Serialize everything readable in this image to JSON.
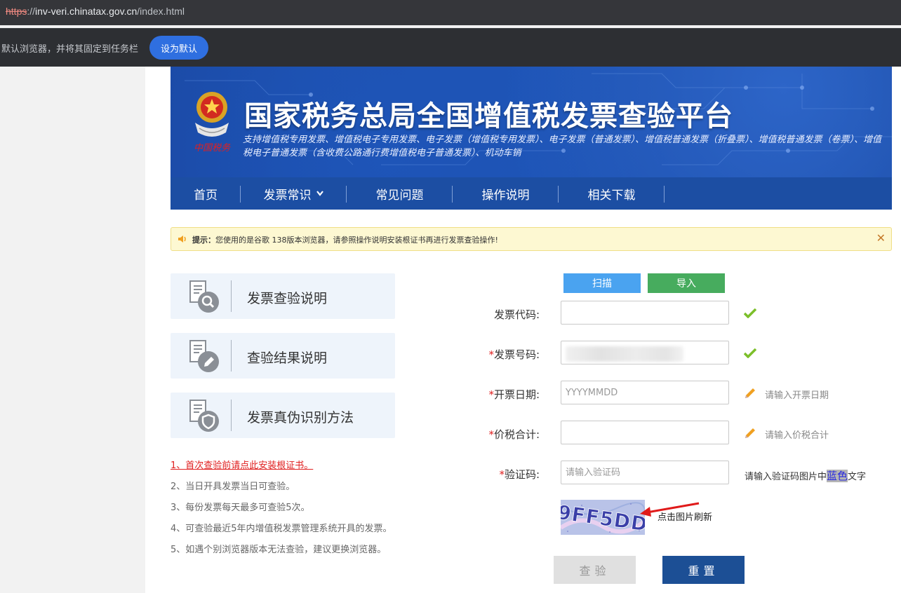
{
  "browser": {
    "url_proto": "https",
    "url_sep": "://",
    "url_host": "inv-veri.chinatax.gov.cn",
    "url_path": "/index.html",
    "infobar_text": "默认浏览器，并将其固定到任务栏",
    "infobar_button": "设为默认"
  },
  "header": {
    "title": "国家税务总局全国增值税发票查验平台",
    "subtitle": "支持增值税专用发票、增值税电子专用发票、电子发票（增值税专用发票）、电子发票（普通发票）、增值税普通发票（折叠票）、增值税普通发票（卷票）、增值税电子普通发票（含收费公路通行费增值税电子普通发票）、机动车销",
    "emblem_text": "中国税务"
  },
  "nav": {
    "items": [
      {
        "label": "首页"
      },
      {
        "label": "发票常识"
      },
      {
        "label": "常见问题"
      },
      {
        "label": "操作说明"
      },
      {
        "label": "相关下载"
      }
    ]
  },
  "alert": {
    "prefix": "提示：",
    "text": "您使用的是谷歌 138版本浏览器，请参照操作说明安装根证书再进行发票查验操作!"
  },
  "cards": [
    {
      "label": "发票查验说明",
      "icon": "document-search-icon"
    },
    {
      "label": "查验结果说明",
      "icon": "document-edit-icon"
    },
    {
      "label": "发票真伪识别方法",
      "icon": "document-shield-icon"
    }
  ],
  "tips": [
    "1、首次查验前请点此安装根证书。",
    "2、当日开具发票当日可查验。",
    "3、每份发票每天最多可查验5次。",
    "4、可查验最近5年内增值税发票管理系统开具的发票。",
    "5、如遇个别浏览器版本无法查验，建议更换浏览器。"
  ],
  "form": {
    "scan_label": "扫描",
    "import_label": "导入",
    "code": {
      "label": "发票代码:",
      "value": ""
    },
    "number": {
      "req": "*",
      "label": "发票号码:",
      "value": ""
    },
    "date": {
      "req": "*",
      "label": "开票日期:",
      "placeholder": "YYYYMMDD",
      "hint": "请输入开票日期"
    },
    "amount": {
      "req": "*",
      "label": "价税合计:",
      "placeholder": "",
      "hint": "请输入价税合计"
    },
    "captcha": {
      "req": "*",
      "label": "验证码:",
      "placeholder": "请输入验证码",
      "hint_before": "请输入验证码图片中",
      "hint_color": "蓝色",
      "hint_after": "文字",
      "image_text": "9FF5DD"
    },
    "refresh_text": "点击图片刷新",
    "query_label": "查验",
    "reset_label": "重置"
  },
  "colors": {
    "brand_blue": "#1c4ea3",
    "check_green": "#7cbf2a",
    "alert_bg": "#fdf8d2",
    "required_red": "#e02020"
  }
}
